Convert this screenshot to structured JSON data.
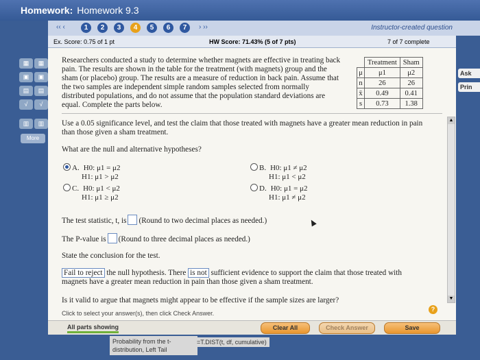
{
  "window": {
    "hw_label": "Homework:",
    "hw_name": "Homework 9.3"
  },
  "nav": {
    "prev": "‹‹ ‹",
    "next": "› ››",
    "questions": [
      "1",
      "2",
      "3",
      "4",
      "5",
      "6",
      "7"
    ],
    "instructor": "Instructor-created question"
  },
  "score": {
    "ex_score": "Ex. Score: 0.75 of 1 pt",
    "hw_score": "HW Score: 71.43% (5 of 7 pts)",
    "progress": "7 of 7 complete"
  },
  "problem_text": "Researchers conducted a study to determine whether magnets are effective in treating back pain. The results are shown in the table for the treatment (with magnets) group and the sham (or placebo) group. The results are a measure of reduction in back pain. Assume that the two samples are independent simple random samples selected from normally distributed populations, and do not assume that the population standard deviations are equal. Complete the parts below.",
  "table": {
    "headers": [
      "Treatment",
      "Sham"
    ],
    "rows": [
      {
        "label": "μ",
        "values": [
          "μ1",
          "μ2"
        ]
      },
      {
        "label": "n",
        "values": [
          "26",
          "26"
        ]
      },
      {
        "label": "x̄",
        "values": [
          "0.49",
          "0.41"
        ]
      },
      {
        "label": "s",
        "values": [
          "0.73",
          "1.38"
        ]
      }
    ]
  },
  "question1": "Use a 0.05 significance level, and test the claim that those treated with magnets have a greater mean reduction in pain than those given a sham treatment.",
  "question2": "What are the null and alternative hypotheses?",
  "options": [
    {
      "letter": "A.",
      "h0": "H0: μ1 = μ2",
      "h1": "H1: μ1 > μ2",
      "selected": true
    },
    {
      "letter": "B.",
      "h0": "H0: μ1 ≠ μ2",
      "h1": "H1: μ1 < μ2",
      "selected": false
    },
    {
      "letter": "C.",
      "h0": "H0: μ1 < μ2",
      "h1": "H1: μ1 ≥ μ2",
      "selected": false
    },
    {
      "letter": "D.",
      "h0": "H0: μ1 = μ2",
      "h1": "H1: μ1 ≠ μ2",
      "selected": false
    }
  ],
  "test_stat": {
    "prefix": "The test statistic, t, is",
    "suffix": "(Round to two decimal places as needed.)"
  },
  "p_value": {
    "prefix": "The P-value is",
    "suffix": "(Round to three decimal places as needed.)"
  },
  "conclusion_label": "State the conclusion for the test.",
  "conclusion": {
    "choice1": "Fail to reject",
    "text1": "the null hypothesis. There",
    "choice2": "is not",
    "text2": "sufficient evidence to support the claim that those treated with magnets have a greater mean reduction in pain than those given a sham treatment."
  },
  "question3": "Is it valid to argue that magnets might appear to be effective if the sample sizes are larger?",
  "click_hint": "Click to select your answer(s), then click Check Answer.",
  "bottom": {
    "all_parts": "All parts showing",
    "clear": "Clear All",
    "check": "Check Answer",
    "save": "Save"
  },
  "tooltip1": "Probability from the t-distribution, Left Tail",
  "tooltip2": "=T.DIST(t, df, cumulative)",
  "side": {
    "ask": "Ask",
    "print": "Prin"
  },
  "leftstrip": {
    "more": "More"
  }
}
